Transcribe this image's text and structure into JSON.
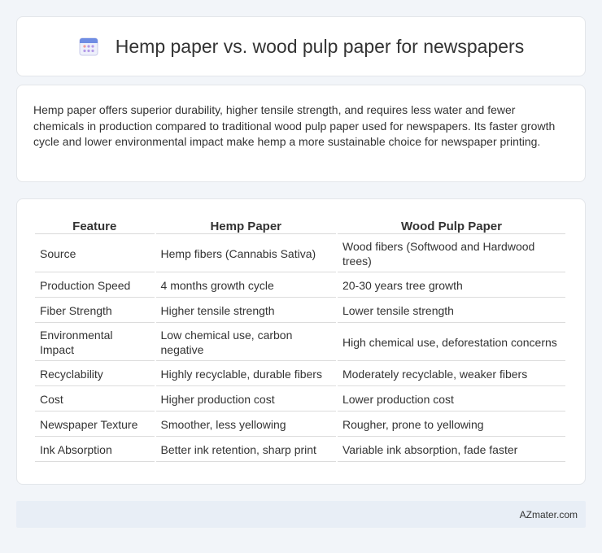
{
  "header": {
    "title": "Hemp paper vs. wood pulp paper for newspapers",
    "icon": "calendar-icon"
  },
  "intro": {
    "text": "Hemp paper offers superior durability, higher tensile strength, and requires less water and fewer chemicals in production compared to traditional wood pulp paper used for newspapers. Its faster growth cycle and lower environmental impact make hemp a more sustainable choice for newspaper printing."
  },
  "table": {
    "headers": [
      "Feature",
      "Hemp Paper",
      "Wood Pulp Paper"
    ],
    "rows": [
      [
        "Source",
        "Hemp fibers (Cannabis Sativa)",
        "Wood fibers (Softwood and Hardwood trees)"
      ],
      [
        "Production Speed",
        "4 months growth cycle",
        "20-30 years tree growth"
      ],
      [
        "Fiber Strength",
        "Higher tensile strength",
        "Lower tensile strength"
      ],
      [
        "Environmental Impact",
        "Low chemical use, carbon negative",
        "High chemical use, deforestation concerns"
      ],
      [
        "Recyclability",
        "Highly recyclable, durable fibers",
        "Moderately recyclable, weaker fibers"
      ],
      [
        "Cost",
        "Higher production cost",
        "Lower production cost"
      ],
      [
        "Newspaper Texture",
        "Smoother, less yellowing",
        "Rougher, prone to yellowing"
      ],
      [
        "Ink Absorption",
        "Better ink retention, sharp print",
        "Variable ink absorption, fade faster"
      ]
    ]
  },
  "footer": {
    "text": "AZmater.com"
  }
}
